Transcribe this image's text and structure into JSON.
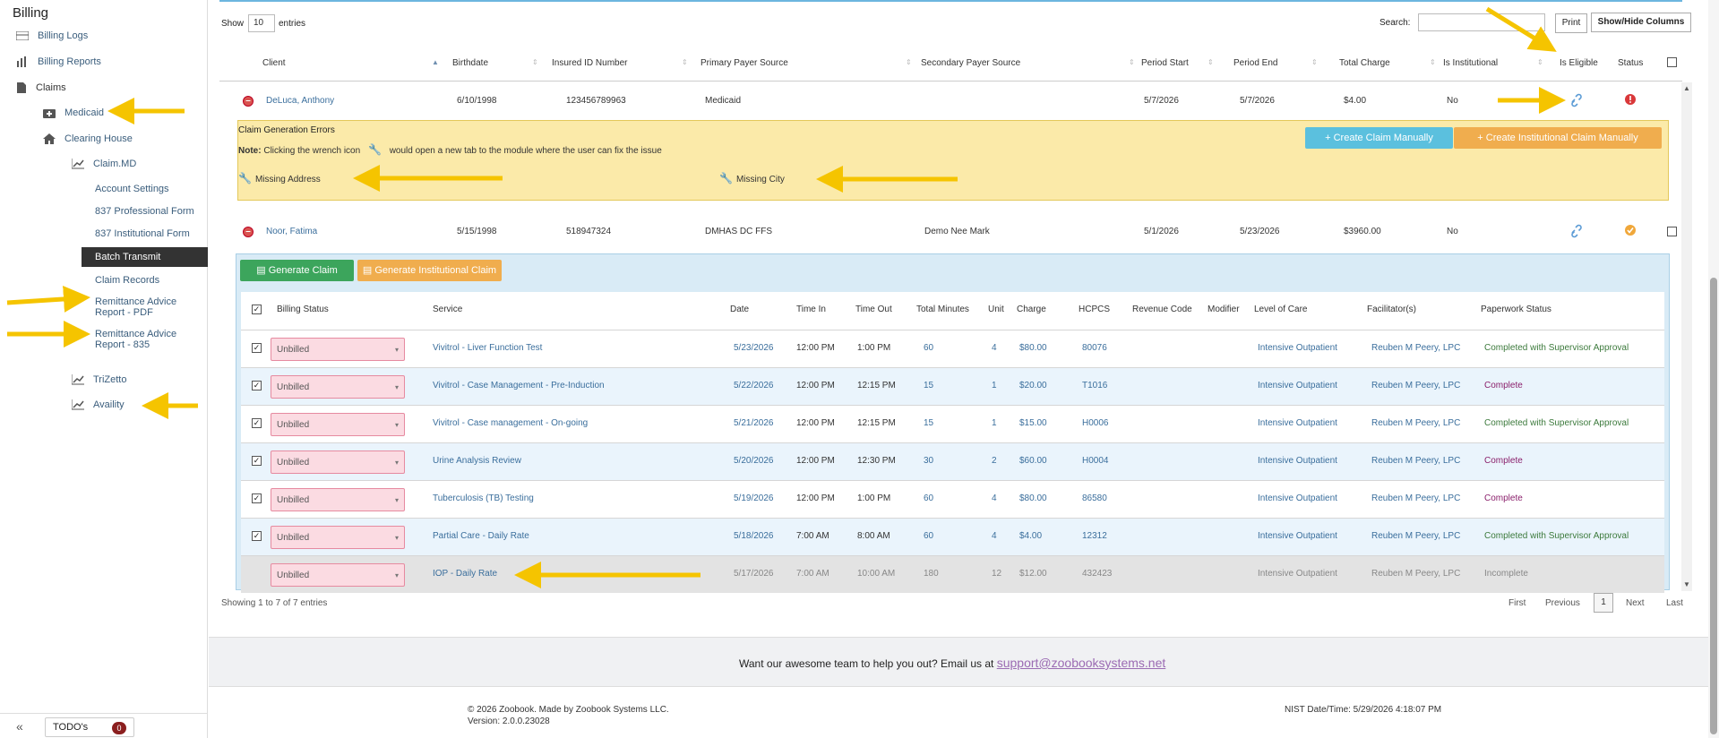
{
  "sidebar": {
    "title": "Billing",
    "items": {
      "billing_logs": "Billing Logs",
      "billing_reports": "Billing Reports",
      "claims": "Claims",
      "medicaid": "Medicaid",
      "clearing_house": "Clearing House",
      "claimmd": "Claim.MD",
      "account_settings": "Account Settings",
      "form_837p": "837 Professional Form",
      "form_837i": "837 Institutional Form",
      "batch_transmit": "Batch Transmit",
      "claim_records": "Claim Records",
      "remit_pdf": "Remittance Advice Report - PDF",
      "remit_835": "Remittance Advice Report - 835",
      "trizetto": "TriZetto",
      "availity": "Availity"
    },
    "todo_label": "TODO's",
    "todo_count": "0",
    "collapse_glyph": "«"
  },
  "controls": {
    "show": "Show",
    "entries_value": "10",
    "entries": "entries",
    "search": "Search:",
    "print": "Print",
    "show_hide": "Show/Hide Columns"
  },
  "columns": [
    "Client",
    "Birthdate",
    "Insured ID Number",
    "Primary Payer Source",
    "Secondary Payer Source",
    "Period Start",
    "Period End",
    "Total Charge",
    "Is Institutional",
    "Is Eligible",
    "Status"
  ],
  "rows": [
    {
      "client": "DeLuca, Anthony",
      "birthdate": "6/10/1998",
      "insured_id": "123456789963",
      "primary": "Medicaid",
      "secondary": "",
      "start": "5/7/2026",
      "end": "5/7/2026",
      "total": "$4.00",
      "institutional": "No"
    },
    {
      "client": "Noor, Fatima",
      "birthdate": "5/15/1998",
      "insured_id": "518947324",
      "primary": "DMHAS DC FFS",
      "secondary": "Demo Nee Mark",
      "start": "5/1/2026",
      "end": "5/23/2026",
      "total": "$3960.00",
      "institutional": "No"
    }
  ],
  "errors": {
    "title": "Claim Generation Errors",
    "note_label": "Note:",
    "note_text_a": "Clicking the wrench icon",
    "note_text_b": "would open a new tab to the module where the user can fix the issue",
    "missing_address": "Missing Address",
    "missing_city": "Missing City",
    "create_manual": "Create Claim Manually",
    "create_inst_manual": "Create Institutional Claim Manually"
  },
  "generate": {
    "claim": "Generate Claim",
    "inst_claim": "Generate Institutional Claim"
  },
  "subcolumns": [
    "Billing Status",
    "Service",
    "Date",
    "Time In",
    "Time Out",
    "Total Minutes",
    "Unit",
    "Charge",
    "HCPCS",
    "Revenue Code",
    "Modifier",
    "Level of Care",
    "Facilitator(s)",
    "Paperwork Status"
  ],
  "services": [
    {
      "checked": "✓",
      "status": "Unbilled",
      "service": "Vivitrol - Liver Function Test",
      "date": "5/23/2026",
      "in": "12:00 PM",
      "out": "1:00 PM",
      "mins": "60",
      "unit": "4",
      "charge": "$80.00",
      "hcpcs": "80076",
      "loc": "Intensive Outpatient",
      "fac": "Reuben M Peery, LPC",
      "paper": "Completed with Supervisor Approval",
      "pclass": "cs-green"
    },
    {
      "checked": "✓",
      "status": "Unbilled",
      "service": "Vivitrol - Case Management - Pre-Induction",
      "date": "5/22/2026",
      "in": "12:00 PM",
      "out": "12:15 PM",
      "mins": "15",
      "unit": "1",
      "charge": "$20.00",
      "hcpcs": "T1016",
      "loc": "Intensive Outpatient",
      "fac": "Reuben M Peery, LPC",
      "paper": "Complete",
      "pclass": "cs-purple"
    },
    {
      "checked": "✓",
      "status": "Unbilled",
      "service": "Vivitrol - Case management - On-going",
      "date": "5/21/2026",
      "in": "12:00 PM",
      "out": "12:15 PM",
      "mins": "15",
      "unit": "1",
      "charge": "$15.00",
      "hcpcs": "H0006",
      "loc": "Intensive Outpatient",
      "fac": "Reuben M Peery, LPC",
      "paper": "Completed with Supervisor Approval",
      "pclass": "cs-green"
    },
    {
      "checked": "✓",
      "status": "Unbilled",
      "service": "Urine Analysis Review",
      "date": "5/20/2026",
      "in": "12:00 PM",
      "out": "12:30 PM",
      "mins": "30",
      "unit": "2",
      "charge": "$60.00",
      "hcpcs": "H0004",
      "loc": "Intensive Outpatient",
      "fac": "Reuben M Peery, LPC",
      "paper": "Complete",
      "pclass": "cs-purple"
    },
    {
      "checked": "✓",
      "status": "Unbilled",
      "service": "Tuberculosis (TB) Testing",
      "date": "5/19/2026",
      "in": "12:00 PM",
      "out": "1:00 PM",
      "mins": "60",
      "unit": "4",
      "charge": "$80.00",
      "hcpcs": "86580",
      "loc": "Intensive Outpatient",
      "fac": "Reuben M Peery, LPC",
      "paper": "Complete",
      "pclass": "cs-purple"
    },
    {
      "checked": "✓",
      "status": "Unbilled",
      "service": "Partial Care - Daily Rate",
      "date": "5/18/2026",
      "in": "7:00 AM",
      "out": "8:00 AM",
      "mins": "60",
      "unit": "4",
      "charge": "$4.00",
      "hcpcs": "12312",
      "loc": "Intensive Outpatient",
      "fac": "Reuben M Peery, LPC",
      "paper": "Completed with Supervisor Approval",
      "pclass": "cs-green"
    },
    {
      "checked": "",
      "status": "Unbilled",
      "service": "IOP - Daily Rate",
      "date": "5/17/2026",
      "in": "7:00 AM",
      "out": "10:00 AM",
      "mins": "180",
      "unit": "12",
      "charge": "$12.00",
      "hcpcs": "432423",
      "loc": "Intensive Outpatient",
      "fac": "Reuben M Peery, LPC",
      "paper": "Incomplete",
      "pclass": "cs-gray"
    }
  ],
  "pagination": {
    "showing": "Showing 1 to 7 of 7 entries",
    "first": "First",
    "previous": "Previous",
    "page": "1",
    "next": "Next",
    "last": "Last"
  },
  "footer": {
    "help": "Want our awesome team to help you out? Email us at",
    "email": "support@zoobooksystems.net",
    "copyright": "© 2026 Zoobook. Made by Zoobook Systems LLC.",
    "version": "Version: 2.0.0.23028",
    "nist": "NIST Date/Time: 5/29/2026 4:18:07 PM"
  },
  "colors": {
    "accent": "#3a6e9c",
    "error_bg": "#fbeaa9",
    "arrow": "#f5c400"
  }
}
